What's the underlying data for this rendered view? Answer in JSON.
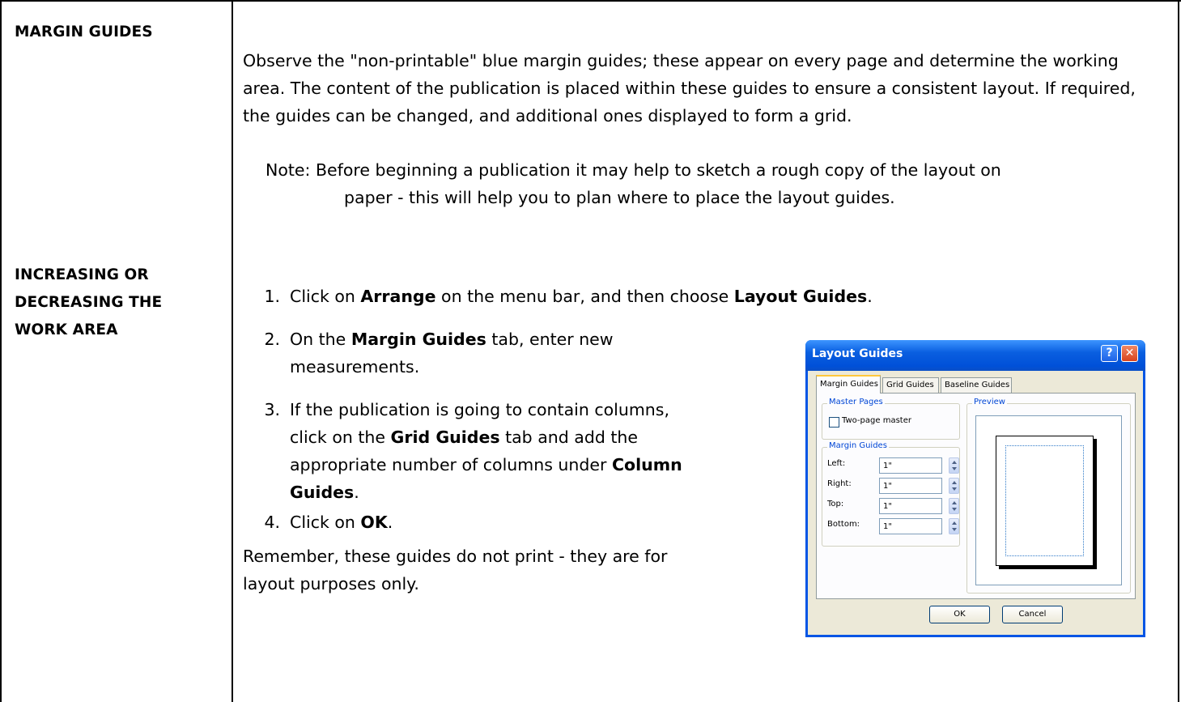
{
  "section1": {
    "heading": "MARGIN GUIDES",
    "paragraph": "Observe the \"non-printable\" blue margin guides; these appear on every page and determine the working area.  The content of the publication is placed within these guides to ensure a consistent layout.  If required, the guides can be changed, and additional ones displayed to form a grid.",
    "note_line1": "Note:  Before beginning a publication it may help to sketch a rough copy of the layout on",
    "note_line2": "paper - this will help you to plan where to place the layout guides."
  },
  "section2": {
    "heading_line1": "INCREASING OR",
    "heading_line2": "DECREASING THE",
    "heading_line3": "WORK AREA",
    "steps": [
      {
        "num": "1.",
        "pre": "Click on ",
        "b1": "Arrange",
        "mid": " on the menu bar, and then choose ",
        "b2": "Layout Guides",
        "post": "."
      },
      {
        "num": "2.",
        "pre": "On the ",
        "b1": "Margin Guides",
        "post": " tab, enter new",
        "line2": "measurements."
      },
      {
        "num": "3.",
        "line1": "If the publication is going to contain columns,",
        "l2pre": "click on the ",
        "l2bold": "Grid Guides",
        "l2post": " tab and add the",
        "l3pre": "appropriate number of columns under ",
        "l3bold": "Column",
        "l4bold": "Guides",
        "l4post": "."
      },
      {
        "num": "4.",
        "pre": "Click on ",
        "b1": "OK",
        "post": "."
      }
    ],
    "remember_line1": "Remember, these guides do not print - they are for",
    "remember_line2": "layout purposes only."
  },
  "dialog": {
    "title": "Layout Guides",
    "help_label": "?",
    "close_label": "✕",
    "tabs": [
      "Margin Guides",
      "Grid Guides",
      "Baseline Guides"
    ],
    "master_pages_label": "Master Pages",
    "two_page_master_label": "Two-page master",
    "two_page_master_checked": false,
    "margin_guides_label": "Margin Guides",
    "fields": [
      {
        "label": "Left:",
        "value": "1\""
      },
      {
        "label": "Right:",
        "value": "1\""
      },
      {
        "label": "Top:",
        "value": "1\""
      },
      {
        "label": "Bottom:",
        "value": "1\""
      }
    ],
    "preview_label": "Preview",
    "ok_label": "OK",
    "cancel_label": "Cancel",
    "colors": {
      "titlebar": "#0055e5",
      "close": "#d9431c",
      "margin_guide": "#2f7ac8"
    }
  }
}
